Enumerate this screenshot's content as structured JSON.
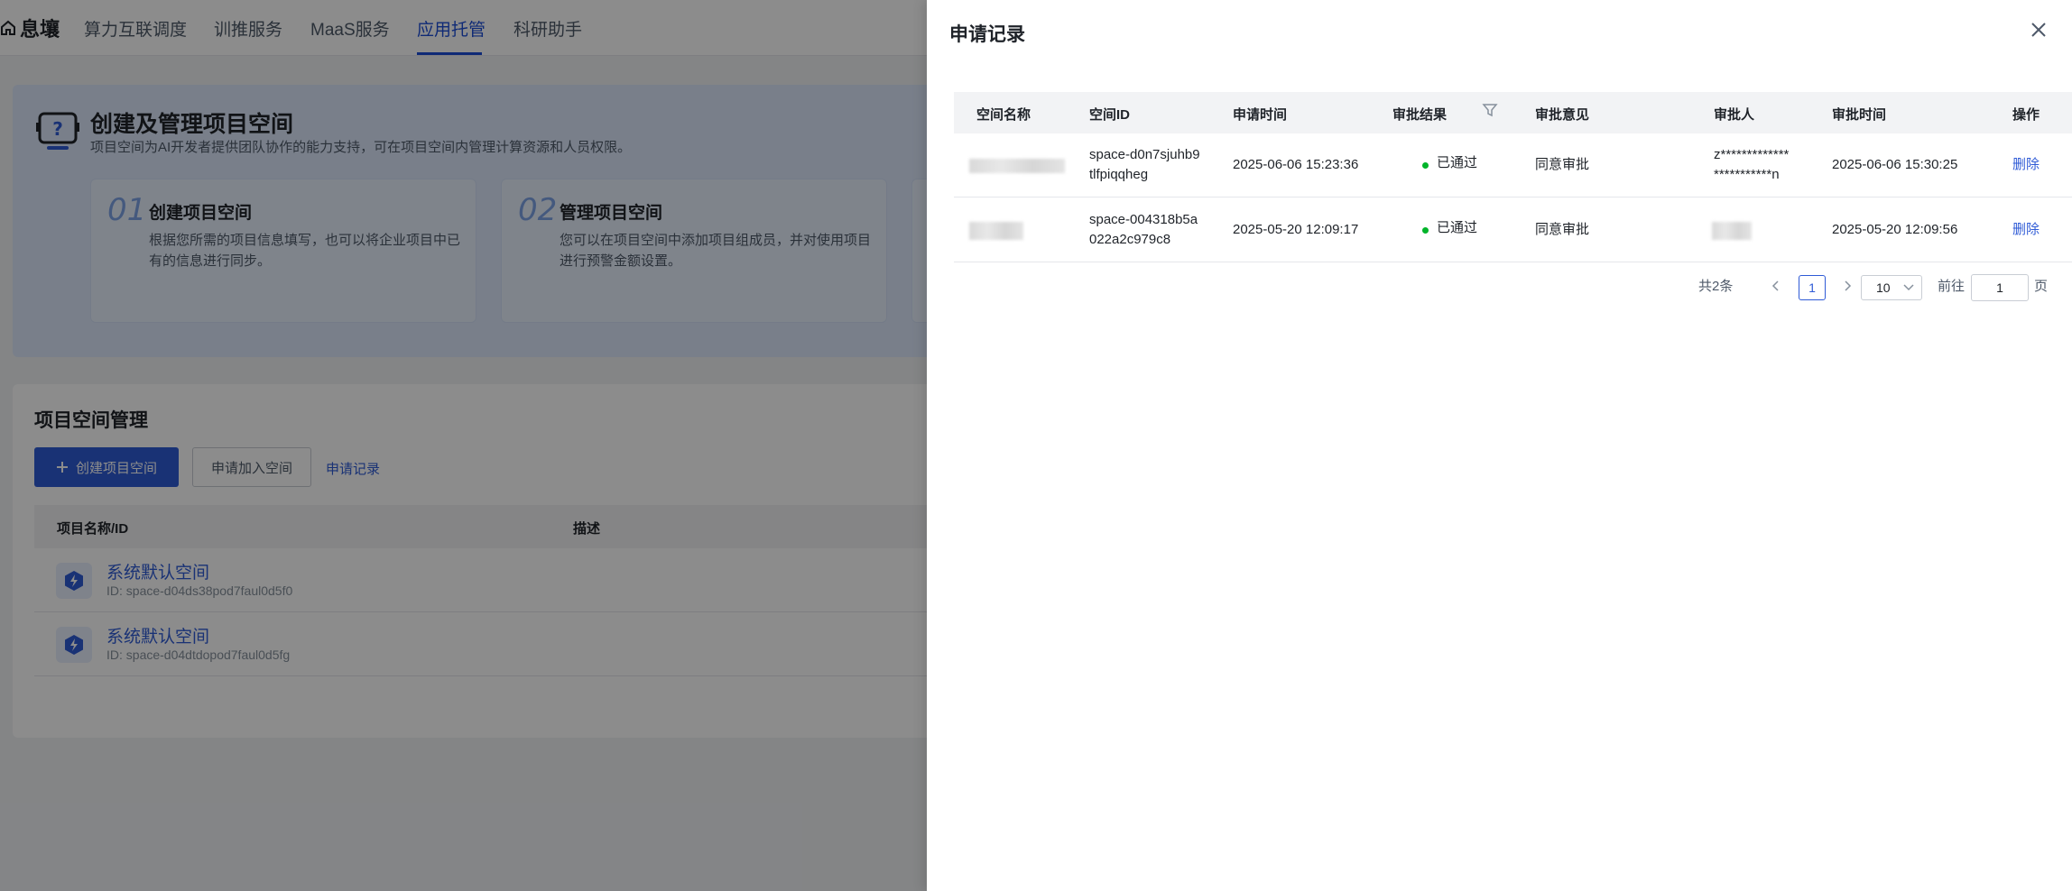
{
  "topnav": {
    "brand": "息壤",
    "items": [
      {
        "label": "算力互联调度"
      },
      {
        "label": "训推服务"
      },
      {
        "label": "MaaS服务"
      },
      {
        "label": "应用托管"
      },
      {
        "label": "科研助手"
      }
    ],
    "active": "应用托管"
  },
  "hero": {
    "title": "创建及管理项目空间",
    "desc": "项目空间为AI开发者提供团队协作的能力支持，可在项目空间内管理计算资源和人员权限。",
    "cards": [
      {
        "num": "01",
        "title": "创建项目空间",
        "desc": "根据您所需的项目信息填写，也可以将企业项目中已有的信息进行同步。"
      },
      {
        "num": "02",
        "title": "管理项目空间",
        "desc": "您可以在项目空间中添加项目组成员，并对使用项目进行预警金额设置。"
      }
    ]
  },
  "panel": {
    "title": "项目空间管理",
    "create_button": "创建项目空间",
    "join_button": "申请加入空间",
    "records_link": "申请记录",
    "columns": [
      "项目名称/ID",
      "描述"
    ],
    "rows": [
      {
        "name": "系统默认空间",
        "id": "ID: space-d04ds38pod7faul0d5f0"
      },
      {
        "name": "系统默认空间",
        "id": "ID: space-d04dtdopod7faul0d5fg"
      }
    ]
  },
  "drawer": {
    "title": "申请记录",
    "columns": {
      "space_name": "空间名称",
      "space_id": "空间ID",
      "apply_time": "申请时间",
      "result": "审批结果",
      "opinion": "审批意见",
      "approver": "审批人",
      "approve_time": "审批时间",
      "action": "操作"
    },
    "rows": [
      {
        "space_id_line1": "space-d0n7sjuhb9",
        "space_id_line2": "tlfpiqqheg",
        "apply_time": "2025-06-06 15:23:36",
        "result": "已通过",
        "opinion": "同意审批",
        "approver_line1": "z*************",
        "approver_line2": "***********n",
        "approve_time": "2025-06-06 15:30:25",
        "action": "删除"
      },
      {
        "space_id_line1": "space-004318b5a",
        "space_id_line2": "022a2c979c8",
        "apply_time": "2025-05-20 12:09:17",
        "result": "已通过",
        "opinion": "同意审批",
        "approve_time": "2025-05-20 12:09:56",
        "action": "删除"
      }
    ],
    "pagination": {
      "total": "共2条",
      "current": "1",
      "page_size": "10",
      "goto_label": "前往",
      "goto_value": "1",
      "goto_unit": "页"
    }
  },
  "colors": {
    "primary": "#2f5bd6",
    "success": "#00b42a",
    "overlay": "rgba(0,0,0,0.45)"
  },
  "icons": [
    "home-icon",
    "question-robot-icon",
    "plus-icon",
    "lightning-icon",
    "close-icon",
    "filter-icon",
    "chevron-left-icon",
    "chevron-right-icon",
    "chevron-down-icon"
  ]
}
